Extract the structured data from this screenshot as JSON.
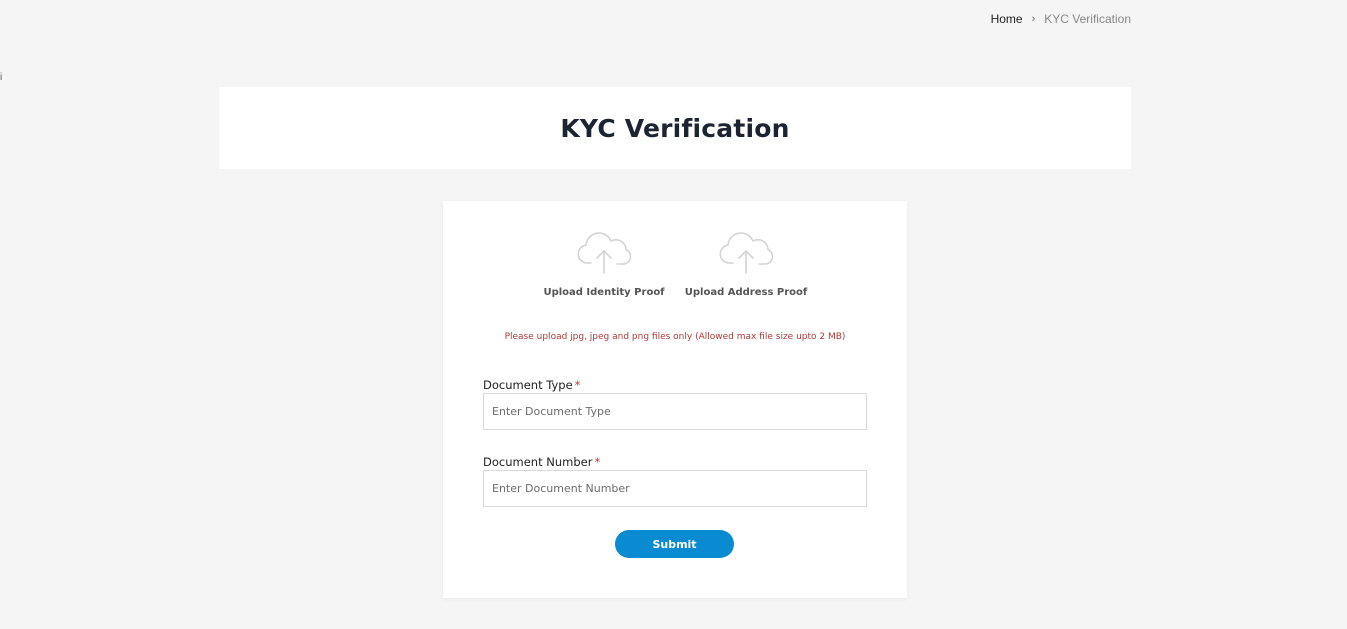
{
  "stray_mark": "i",
  "breadcrumb": {
    "home": "Home",
    "separator": "›",
    "current": "KYC Verification"
  },
  "page": {
    "title": "KYC Verification"
  },
  "uploads": [
    {
      "label": "Upload Identity Proof",
      "icon": "cloud-upload-icon"
    },
    {
      "label": "Upload Address Proof",
      "icon": "cloud-upload-icon"
    }
  ],
  "upload_note": "Please upload jpg, jpeg and png files only (Allowed max file size upto 2 MB)",
  "form": {
    "document_type": {
      "label": "Document Type",
      "required_mark": "*",
      "placeholder": "Enter Document Type",
      "value": ""
    },
    "document_number": {
      "label": "Document Number",
      "required_mark": "*",
      "placeholder": "Enter Document Number",
      "value": ""
    },
    "submit_label": "Submit"
  },
  "colors": {
    "background": "#f5f5f5",
    "accent": "#0a8ad1",
    "note": "#b03a3a",
    "required": "#d0312d"
  }
}
